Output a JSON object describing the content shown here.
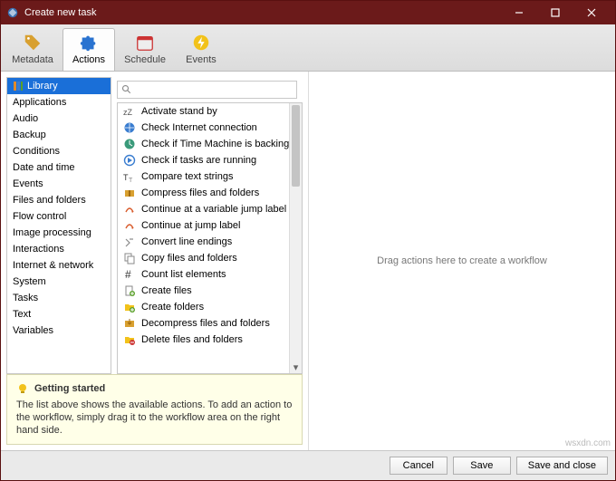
{
  "window": {
    "title": "Create new task"
  },
  "toolbar": {
    "tabs": [
      {
        "label": "Metadata"
      },
      {
        "label": "Actions"
      },
      {
        "label": "Schedule"
      },
      {
        "label": "Events"
      }
    ],
    "active_index": 1
  },
  "search": {
    "placeholder": ""
  },
  "categories": {
    "selected_index": 0,
    "items": [
      {
        "label": "Library"
      },
      {
        "label": "Applications"
      },
      {
        "label": "Audio"
      },
      {
        "label": "Backup"
      },
      {
        "label": "Conditions"
      },
      {
        "label": "Date and time"
      },
      {
        "label": "Events"
      },
      {
        "label": "Files and folders"
      },
      {
        "label": "Flow control"
      },
      {
        "label": "Image processing"
      },
      {
        "label": "Interactions"
      },
      {
        "label": "Internet & network"
      },
      {
        "label": "System"
      },
      {
        "label": "Tasks"
      },
      {
        "label": "Text"
      },
      {
        "label": "Variables"
      }
    ]
  },
  "actions": {
    "items": [
      {
        "label": "Activate stand by"
      },
      {
        "label": "Check Internet connection"
      },
      {
        "label": "Check if Time Machine is backing up data"
      },
      {
        "label": "Check if tasks are running"
      },
      {
        "label": "Compare text strings"
      },
      {
        "label": "Compress files and folders"
      },
      {
        "label": "Continue at a variable jump label"
      },
      {
        "label": "Continue at jump label"
      },
      {
        "label": "Convert line endings"
      },
      {
        "label": "Copy files and folders"
      },
      {
        "label": "Count list elements"
      },
      {
        "label": "Create files"
      },
      {
        "label": "Create folders"
      },
      {
        "label": "Decompress files and folders"
      },
      {
        "label": "Delete files and folders"
      }
    ]
  },
  "hint": {
    "title": "Getting started",
    "body": "The list above shows the available actions. To add an action to the workflow, simply drag it to the workflow area on the right hand side."
  },
  "workflow": {
    "placeholder": "Drag actions here to create a workflow"
  },
  "footer": {
    "cancel": "Cancel",
    "save": "Save",
    "save_close": "Save and close"
  },
  "watermark": "wsxdn.com"
}
